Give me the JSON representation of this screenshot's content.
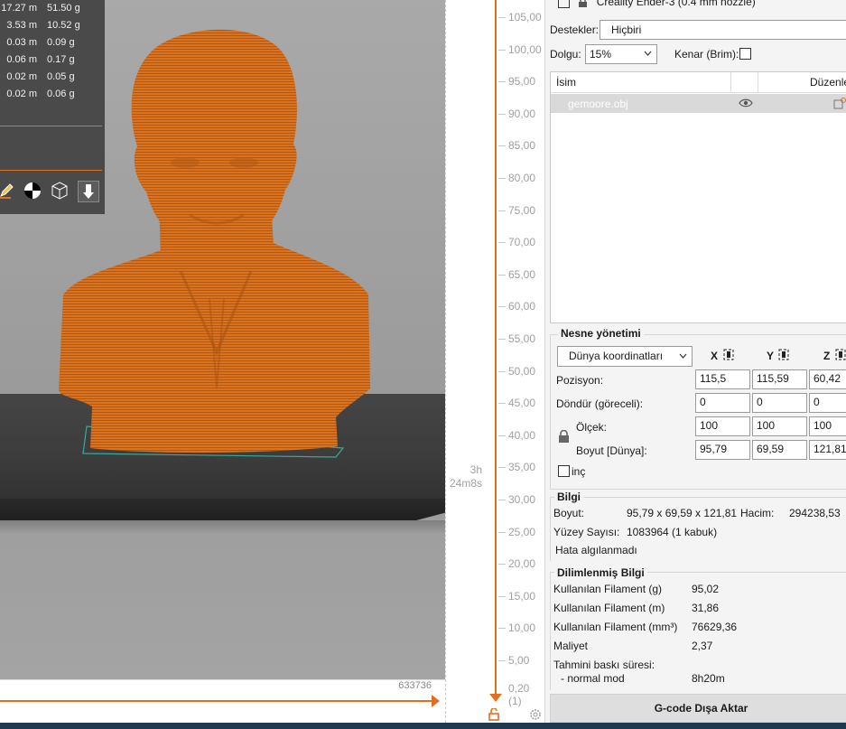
{
  "stats": {
    "rows": [
      {
        "length": "17.27 m",
        "weight": "51.50 g"
      },
      {
        "length": "3.53 m",
        "weight": "10.52 g"
      },
      {
        "length": "0.03 m",
        "weight": "0.09 g"
      },
      {
        "length": "0.06 m",
        "weight": "0.17 g"
      },
      {
        "length": "0.02 m",
        "weight": "0.05 g"
      },
      {
        "length": "0.02 m",
        "weight": "0.06 g"
      }
    ]
  },
  "viewport": {
    "tool_icons": [
      "paint-icon",
      "center-icon",
      "wireframe-cube-icon",
      "arrow-down-icon"
    ],
    "horizontal_slider_count": "633736"
  },
  "layer_slider": {
    "ticks": [
      "105,00",
      "100,00",
      "95,00",
      "90,00",
      "85,00",
      "80,00",
      "75,00",
      "70,00",
      "65,00",
      "60,00",
      "55,00",
      "50,00",
      "45,00",
      "40,00",
      "35,00",
      "30,00",
      "25,00",
      "20,00",
      "15,00",
      "10,00",
      "5,00"
    ],
    "bottom_value": "0,20",
    "bottom_index": "(1)",
    "time_line1": "3h",
    "time_line2": "24m8s"
  },
  "panel": {
    "printer_name": "Creality Ender-3 (0.4 mm nozzle)",
    "supports_label": "Destekler:",
    "supports_value": "Hiçbiri",
    "infill_label": "Dolgu:",
    "infill_value": "15%",
    "brim_label": "Kenar (Brim):",
    "list_header_name": "İsim",
    "list_header_edit": "Düzenle",
    "object_name": "gemoore.obj",
    "object_management": {
      "title": "Nesne yönetimi",
      "coord_select": "Dünya koordinatları",
      "col_x": "X",
      "col_y": "Y",
      "col_z": "Z",
      "position_label": "Pozisyon:",
      "position": [
        "115,5",
        "115,59",
        "60,42"
      ],
      "rotate_label": "Döndür (göreceli):",
      "rotate": [
        "0",
        "0",
        "0"
      ],
      "scale_label": "Ölçek:",
      "scale": [
        "100",
        "100",
        "100"
      ],
      "size_label": "Boyut [Dünya]:",
      "size": [
        "95,79",
        "69,59",
        "121,81"
      ],
      "inch_label": "inç"
    },
    "info": {
      "title": "Bilgi",
      "size_label": "Boyut:",
      "size_value": "95,79 x 69,59 x 121,81",
      "volume_label": "Hacim:",
      "volume_value": "294238,53",
      "faces_label": "Yüzey Sayısı:",
      "faces_value": "1083964 (1 kabuk)",
      "errors": "Hata algılanmadı"
    },
    "sliced": {
      "title": "Dilimlenmiş Bilgi",
      "filament_g_label": "Kullanılan Filament (g)",
      "filament_g": "95,02",
      "filament_m_label": "Kullanılan Filament (m)",
      "filament_m": "31,86",
      "filament_mm3_label": "Kullanılan Filament (mm³)",
      "filament_mm3": "76629,36",
      "cost_label": "Maliyet",
      "cost": "2,37",
      "time_label": "Tahmini baskı süresi:",
      "mode_label": "- normal mod",
      "mode_time": "8h20m"
    },
    "export_button": "G-code Dışa Aktar"
  }
}
